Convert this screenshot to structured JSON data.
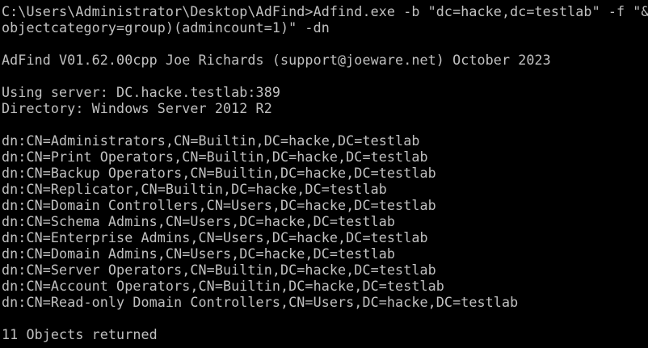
{
  "console": {
    "command_line_1": "C:\\Users\\Administrator\\Desktop\\AdFind>Adfind.exe -b \"dc=hacke,dc=testlab\" -f \"&(",
    "command_line_2": "objectcategory=group)(admincount=1)\" -dn",
    "banner": "AdFind V01.62.00cpp Joe Richards (support@joeware.net) October 2023",
    "server_line": "Using server: DC.hacke.testlab:389",
    "directory_line": "Directory: Windows Server 2012 R2",
    "results": [
      "dn:CN=Administrators,CN=Builtin,DC=hacke,DC=testlab",
      "dn:CN=Print Operators,CN=Builtin,DC=hacke,DC=testlab",
      "dn:CN=Backup Operators,CN=Builtin,DC=hacke,DC=testlab",
      "dn:CN=Replicator,CN=Builtin,DC=hacke,DC=testlab",
      "dn:CN=Domain Controllers,CN=Users,DC=hacke,DC=testlab",
      "dn:CN=Schema Admins,CN=Users,DC=hacke,DC=testlab",
      "dn:CN=Enterprise Admins,CN=Users,DC=hacke,DC=testlab",
      "dn:CN=Domain Admins,CN=Users,DC=hacke,DC=testlab",
      "dn:CN=Server Operators,CN=Builtin,DC=hacke,DC=testlab",
      "dn:CN=Account Operators,CN=Builtin,DC=hacke,DC=testlab",
      "dn:CN=Read-only Domain Controllers,CN=Users,DC=hacke,DC=testlab"
    ],
    "summary": "11 Objects returned"
  }
}
